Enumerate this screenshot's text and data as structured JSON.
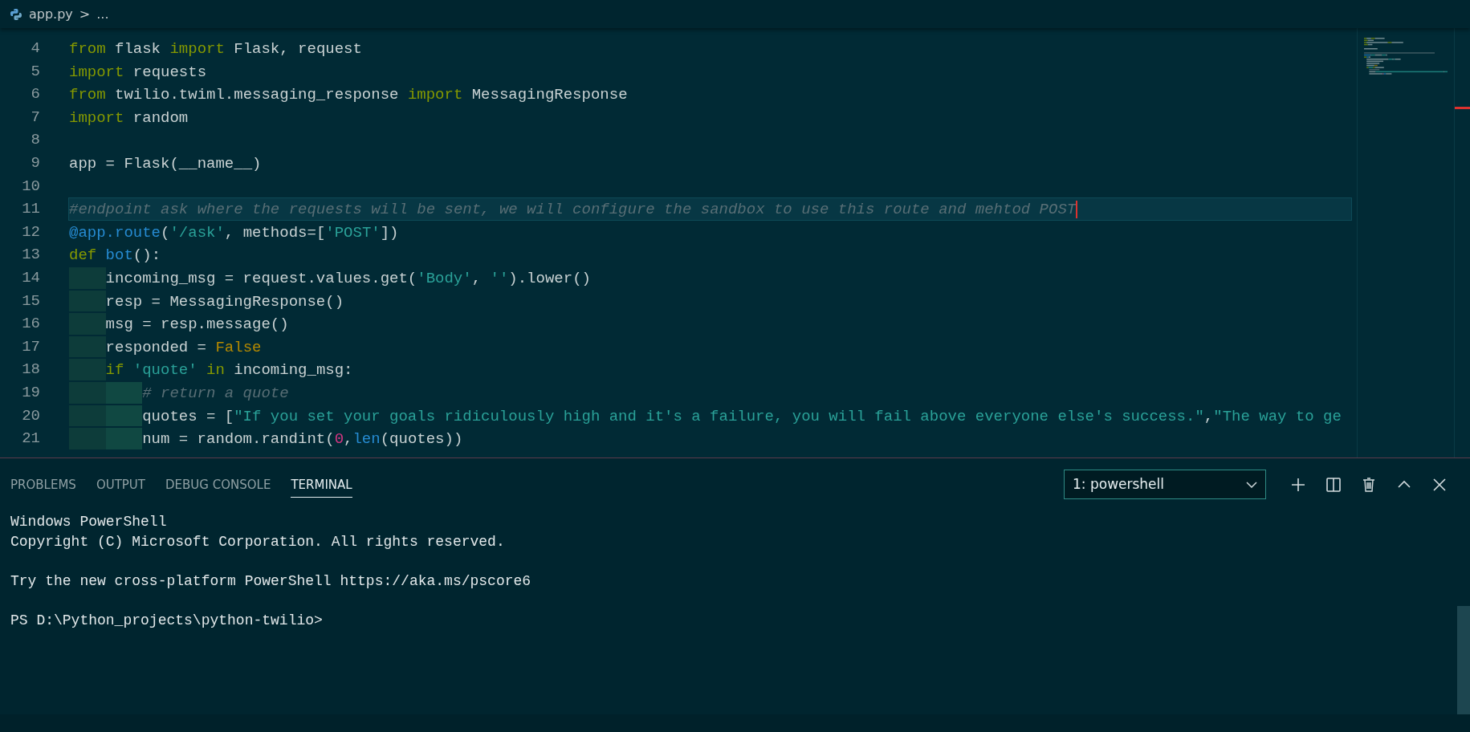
{
  "breadcrumb": {
    "file": "app.py",
    "separator": ">",
    "rest": "..."
  },
  "editor": {
    "lines": [
      {
        "number": "4",
        "current": false,
        "tokens": [
          {
            "text": "from",
            "kind": "keyword"
          },
          {
            "text": " flask ",
            "kind": "plain"
          },
          {
            "text": "import",
            "kind": "keyword"
          },
          {
            "text": " Flask, request",
            "kind": "plain"
          }
        ]
      },
      {
        "number": "5",
        "current": false,
        "tokens": [
          {
            "text": "import",
            "kind": "keyword"
          },
          {
            "text": " requests",
            "kind": "plain"
          }
        ]
      },
      {
        "number": "6",
        "current": false,
        "tokens": [
          {
            "text": "from",
            "kind": "keyword"
          },
          {
            "text": " twilio.twiml.messaging_response ",
            "kind": "plain"
          },
          {
            "text": "import",
            "kind": "keyword"
          },
          {
            "text": " MessagingResponse",
            "kind": "plain"
          }
        ]
      },
      {
        "number": "7",
        "current": false,
        "tokens": [
          {
            "text": "import",
            "kind": "keyword"
          },
          {
            "text": " random",
            "kind": "plain"
          }
        ]
      },
      {
        "number": "8",
        "current": false
      },
      {
        "number": "9",
        "current": false,
        "tokens": [
          {
            "text": "app = Flask(__name__)",
            "kind": "plain"
          }
        ]
      },
      {
        "number": "10",
        "current": false
      },
      {
        "number": "11",
        "current": true,
        "tokens": [
          {
            "text": "#endpoint ask where the requests will be sent, we will configure the sandbox to use this route and mehtod POST",
            "kind": "comment"
          }
        ]
      },
      {
        "number": "12",
        "current": false,
        "tokens": [
          {
            "text": "@app.route",
            "kind": "function"
          },
          {
            "text": "(",
            "kind": "plain"
          },
          {
            "text": "'/ask'",
            "kind": "string"
          },
          {
            "text": ", methods=[",
            "kind": "plain"
          },
          {
            "text": "'POST'",
            "kind": "string"
          },
          {
            "text": "])",
            "kind": "plain"
          }
        ]
      },
      {
        "number": "13",
        "current": false,
        "tokens": [
          {
            "text": "def ",
            "kind": "keyword"
          },
          {
            "text": "bot",
            "kind": "function"
          },
          {
            "text": "():",
            "kind": "plain"
          }
        ]
      },
      {
        "number": "14",
        "current": false,
        "tokens": [
          {
            "kind": "indent"
          },
          {
            "text": "incoming_msg = request.values.get(",
            "kind": "plain"
          },
          {
            "text": "'Body'",
            "kind": "string"
          },
          {
            "text": ", ",
            "kind": "plain"
          },
          {
            "text": "''",
            "kind": "string"
          },
          {
            "text": ").lower()",
            "kind": "plain"
          }
        ]
      },
      {
        "number": "15",
        "current": false,
        "tokens": [
          {
            "kind": "indent"
          },
          {
            "text": "resp = MessagingResponse()",
            "kind": "plain"
          }
        ]
      },
      {
        "number": "16",
        "current": false,
        "tokens": [
          {
            "kind": "indent"
          },
          {
            "text": "msg = resp.message()",
            "kind": "plain"
          }
        ]
      },
      {
        "number": "17",
        "current": false,
        "tokens": [
          {
            "kind": "indent"
          },
          {
            "text": "responded = ",
            "kind": "plain"
          },
          {
            "text": "False",
            "kind": "constant"
          }
        ]
      },
      {
        "number": "18",
        "current": false,
        "tokens": [
          {
            "kind": "indent"
          },
          {
            "text": "if ",
            "kind": "keyword"
          },
          {
            "text": "'quote'",
            "kind": "string"
          },
          {
            "text": " in",
            "kind": "keyword"
          },
          {
            "text": " incoming_msg:",
            "kind": "plain"
          }
        ]
      },
      {
        "number": "19",
        "current": false,
        "tokens": [
          {
            "kind": "indent"
          },
          {
            "kind": "indent"
          },
          {
            "text": "# return a quote",
            "kind": "comment"
          }
        ]
      },
      {
        "number": "20",
        "current": false,
        "tokens": [
          {
            "kind": "indent"
          },
          {
            "kind": "indent"
          },
          {
            "text": "quotes = [",
            "kind": "plain"
          },
          {
            "text": "\"If you set your goals ridiculously high and it's a failure, you will fail above everyone else's success.\"",
            "kind": "string"
          },
          {
            "text": ",",
            "kind": "plain"
          },
          {
            "text": "\"The way to ge",
            "kind": "string"
          }
        ]
      },
      {
        "number": "21",
        "current": false,
        "tokens": [
          {
            "kind": "indent"
          },
          {
            "kind": "indent"
          },
          {
            "text": "num = random.randint(",
            "kind": "plain"
          },
          {
            "text": "0",
            "kind": "number"
          },
          {
            "text": ",",
            "kind": "plain"
          },
          {
            "text": "len",
            "kind": "function"
          },
          {
            "text": "(quotes))",
            "kind": "plain"
          }
        ]
      }
    ]
  },
  "panel": {
    "tabs": [
      {
        "label": "PROBLEMS",
        "selected": false
      },
      {
        "label": "OUTPUT",
        "selected": false
      },
      {
        "label": "DEBUG CONSOLE",
        "selected": false
      },
      {
        "label": "TERMINAL",
        "selected": true
      }
    ],
    "terminal_select": "1: powershell",
    "terminal_blocks": [
      [
        "Windows PowerShell",
        "Copyright (C) Microsoft Corporation. All rights reserved."
      ],
      [
        "Try the new cross-platform PowerShell https://aka.ms/pscore6"
      ],
      [
        "PS D:\\Python_projects\\python-twilio>"
      ]
    ]
  }
}
